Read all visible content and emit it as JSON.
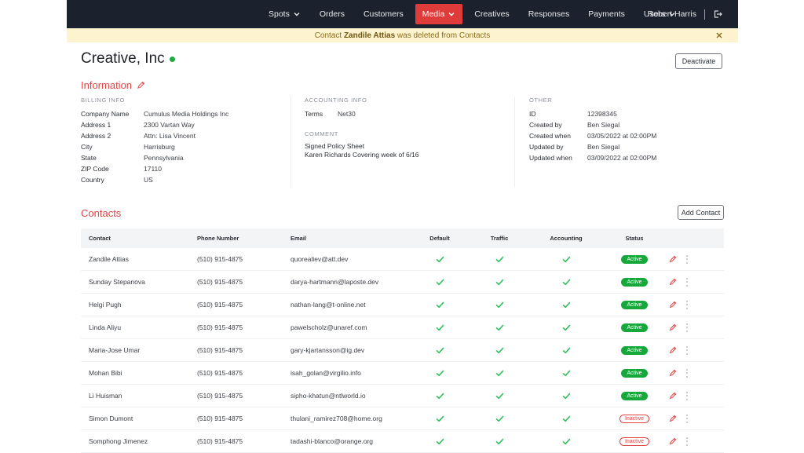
{
  "nav": {
    "items": [
      {
        "label": "Spots",
        "dropdown": true,
        "active": false
      },
      {
        "label": "Orders",
        "dropdown": false,
        "active": false
      },
      {
        "label": "Customers",
        "dropdown": false,
        "active": false
      },
      {
        "label": "Media",
        "dropdown": true,
        "active": true
      },
      {
        "label": "Creatives",
        "dropdown": false,
        "active": false
      },
      {
        "label": "Responses",
        "dropdown": false,
        "active": false
      },
      {
        "label": "Payments",
        "dropdown": false,
        "active": false
      },
      {
        "label": "Users",
        "dropdown": true,
        "active": false
      }
    ],
    "user_name": "Robert Harris",
    "logout_icon": "logout-icon"
  },
  "banner": {
    "prefix": "Contact",
    "name": "Zandile Attias",
    "suffix": "was deleted from Contacts",
    "close_icon": "close-icon"
  },
  "page": {
    "title": "Creative, Inc",
    "status": "active",
    "deactivate_label": "Deactivate"
  },
  "information": {
    "title": "Information",
    "billing": {
      "label": "BILLING INFO",
      "rows": [
        {
          "k": "Company Name",
          "v": "Cumulus Media Holdings Inc"
        },
        {
          "k": "Address 1",
          "v": "2300 Vartan Way"
        },
        {
          "k": "Address 2",
          "v": "Attn: Lisa Vincent"
        },
        {
          "k": "City",
          "v": "Harrisburg"
        },
        {
          "k": "State",
          "v": "Pennsylvania"
        },
        {
          "k": "ZIP Code",
          "v": "17110"
        },
        {
          "k": "Country",
          "v": "US"
        }
      ]
    },
    "accounting": {
      "label": "ACCOUNTING INFO",
      "rows": [
        {
          "k": "Terms",
          "v": "Net30"
        }
      ],
      "comment_label": "COMMENT",
      "comment_lines": [
        "Signed Policy Sheet",
        "Karen Richards Covering week of 6/16"
      ]
    },
    "other": {
      "label": "OTHER",
      "rows": [
        {
          "k": "ID",
          "v": "12398345"
        },
        {
          "k": "Created by",
          "v": "Ben Siegal"
        },
        {
          "k": "Created when",
          "v": "03/05/2022 at 02:00PM"
        },
        {
          "k": "Updated by",
          "v": "Ben Siegal"
        },
        {
          "k": "Updated when",
          "v": "03/09/2022 at 02:00PM"
        }
      ]
    }
  },
  "contacts": {
    "title": "Contacts",
    "add_label": "Add Contact",
    "columns": [
      "Contact",
      "Phone Number",
      "Email",
      "Default",
      "Traffic",
      "Accounting",
      "Status"
    ],
    "rows": [
      {
        "name": "Zandile Attias",
        "phone": "(510) 915-4875",
        "email": "quorealiev@att.dev",
        "default": true,
        "traffic": true,
        "accounting": true,
        "status": "Active"
      },
      {
        "name": "Sunday Stepanova",
        "phone": "(510) 915-4875",
        "email": "darya-hartmann@laposte.dev",
        "default": true,
        "traffic": true,
        "accounting": true,
        "status": "Active"
      },
      {
        "name": "Helgi Pugh",
        "phone": "(510) 915-4875",
        "email": "nathan-lang@t-online.net",
        "default": true,
        "traffic": true,
        "accounting": true,
        "status": "Active"
      },
      {
        "name": "Linda Aliyu",
        "phone": "(510) 915-4875",
        "email": "pawelscholz@unaref.com",
        "default": true,
        "traffic": true,
        "accounting": true,
        "status": "Active"
      },
      {
        "name": "Maria-Jose Umar",
        "phone": "(510) 915-4875",
        "email": "gary-kjartansson@ig.dev",
        "default": true,
        "traffic": true,
        "accounting": true,
        "status": "Active"
      },
      {
        "name": "Mohan Bibi",
        "phone": "(510) 915-4875",
        "email": "isah_golan@virgilio.info",
        "default": true,
        "traffic": true,
        "accounting": true,
        "status": "Active"
      },
      {
        "name": "Li Huisman",
        "phone": "(510) 915-4875",
        "email": "sipho-khatun@ntlworld.io",
        "default": true,
        "traffic": true,
        "accounting": true,
        "status": "Active"
      },
      {
        "name": "Simon Dumont",
        "phone": "(510) 915-4875",
        "email": "thulani_ramirez708@home.org",
        "default": true,
        "traffic": true,
        "accounting": true,
        "status": "Inactive"
      },
      {
        "name": "Somphong Jimenez",
        "phone": "(510) 915-4875",
        "email": "tadashi-blanco@orange.org",
        "default": true,
        "traffic": true,
        "accounting": true,
        "status": "Inactive"
      }
    ]
  },
  "colors": {
    "nav_bg": "#1c222d",
    "accent_red": "#df3b3b",
    "active_green": "#17a83b",
    "check_green": "#2fbf5a",
    "banner_bg": "#fdf3cf"
  }
}
